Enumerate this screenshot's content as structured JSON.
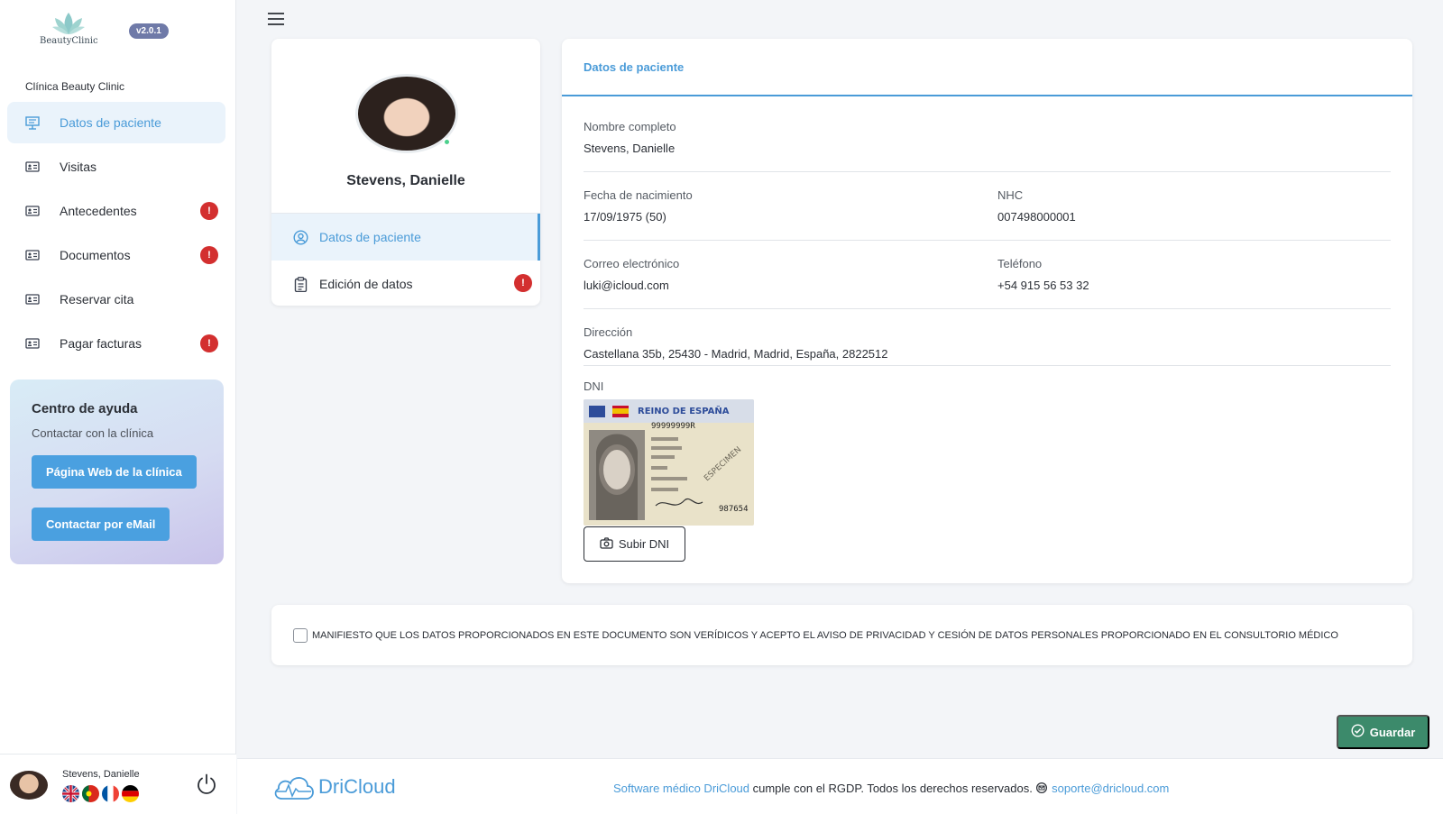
{
  "brand": {
    "logo_text": "BeautyClinic",
    "version": "v2.0.1"
  },
  "sidebar": {
    "clinic_label": "Clínica Beauty Clinic",
    "items": [
      {
        "label": "Datos de paciente",
        "icon": "presentation-icon",
        "active": true,
        "alert": false
      },
      {
        "label": "Visitas",
        "icon": "id-card-icon",
        "active": false,
        "alert": false
      },
      {
        "label": "Antecedentes",
        "icon": "id-card-icon",
        "active": false,
        "alert": true
      },
      {
        "label": "Documentos",
        "icon": "id-card-icon",
        "active": false,
        "alert": true
      },
      {
        "label": "Reservar cita",
        "icon": "id-card-icon",
        "active": false,
        "alert": false
      },
      {
        "label": "Pagar facturas",
        "icon": "id-card-icon",
        "active": false,
        "alert": true
      }
    ],
    "alert_symbol": "!"
  },
  "help": {
    "title": "Centro de ayuda",
    "subtitle": "Contactar con la clínica",
    "web_button": "Página Web de la clínica",
    "email_button": "Contactar por eMail"
  },
  "user": {
    "name": "Stevens, Danielle",
    "flags": [
      "uk-flag-icon",
      "portugal-flag-icon",
      "france-flag-icon",
      "germany-flag-icon"
    ]
  },
  "profile": {
    "name": "Stevens, Danielle",
    "menu": [
      {
        "label": "Datos de paciente",
        "icon": "user-circle-icon",
        "active": true,
        "alert": false
      },
      {
        "label": "Edición de datos",
        "icon": "clipboard-icon",
        "active": false,
        "alert": true
      }
    ]
  },
  "details": {
    "header": "Datos de paciente",
    "full_name": {
      "label": "Nombre completo",
      "value": "Stevens, Danielle"
    },
    "birth_date": {
      "label": "Fecha de nacimiento",
      "value": "17/09/1975 (50)"
    },
    "nhc": {
      "label": "NHC",
      "value": "007498000001"
    },
    "email": {
      "label": "Correo electrónico",
      "value": "luki@icloud.com"
    },
    "phone": {
      "label": "Teléfono",
      "value": "+54 915 56 53 32"
    },
    "address": {
      "label": "Dirección",
      "value": "Castellana 35b, 25430 - Madrid, Madrid, España, 2822512"
    },
    "dni": {
      "label": "DNI",
      "upload_button": "Subir DNI",
      "card_country": "REINO DE ESPAÑA",
      "card_number": "99999999R",
      "card_mark": "ESPECIMEN",
      "card_code": "987654"
    }
  },
  "consent": {
    "checked": false,
    "text": "MANIFIESTO QUE LOS DATOS PROPORCIONADOS EN ESTE DOCUMENTO SON VERÍDICOS Y ACEPTO EL AVISO DE PRIVACIDAD Y CESIÓN DE DATOS PERSONALES PROPORCIONADO EN EL CONSULTORIO MÉDICO"
  },
  "actions": {
    "save": "Guardar"
  },
  "footer": {
    "brand": "DriCloud",
    "link_text": "Software médico DriCloud",
    "text": " cumple con el RGDP. Todos los derechos reservados. ",
    "support_email": "soporte@dricloud.com"
  },
  "colors": {
    "accent": "#4a9bd8",
    "alert": "#d32f2f",
    "save": "#3c8a6b",
    "version_badge": "#6f7aa8"
  }
}
